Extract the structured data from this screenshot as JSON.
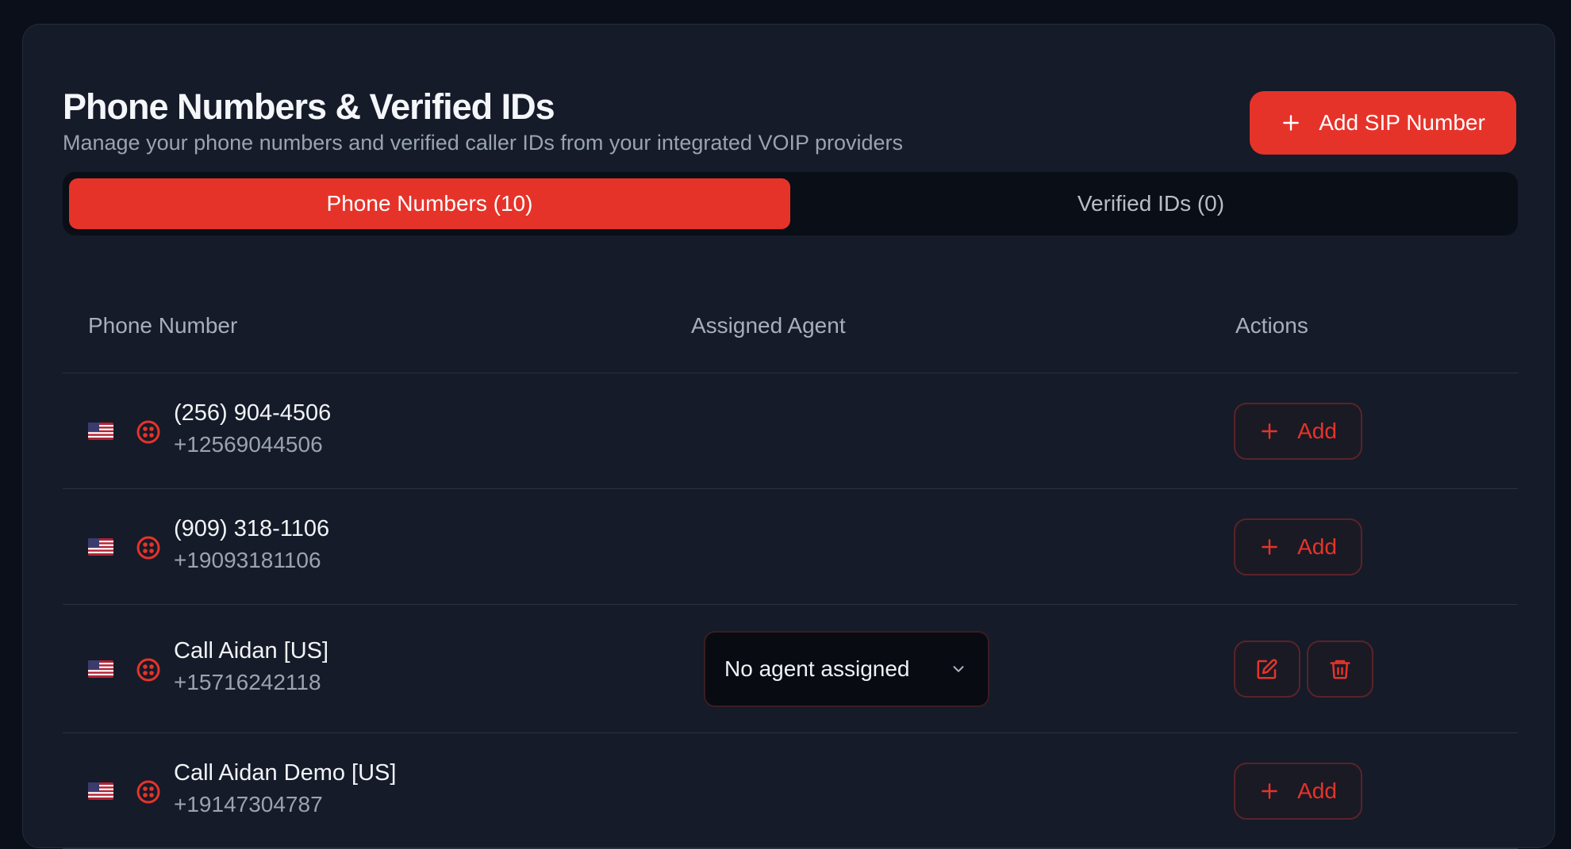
{
  "header": {
    "title": "Phone Numbers & Verified IDs",
    "subtitle": "Manage your phone numbers and verified caller IDs from your integrated VOIP providers",
    "add_sip_label": "Add SIP Number"
  },
  "tabs": [
    {
      "label": "Phone Numbers (10)",
      "active": true
    },
    {
      "label": "Verified IDs (0)",
      "active": false
    }
  ],
  "table": {
    "columns": [
      "Phone Number",
      "Assigned Agent",
      "Actions"
    ],
    "rows": [
      {
        "name": "(256) 904-4506",
        "number": "+12569044506",
        "agent": null,
        "action": "Add"
      },
      {
        "name": "(909) 318-1106",
        "number": "+19093181106",
        "agent": null,
        "action": "Add"
      },
      {
        "name": "Call Aidan [US]",
        "number": "+15716242118",
        "agent": "No agent assigned",
        "action": "edit-delete"
      },
      {
        "name": "Call Aidan Demo [US]",
        "number": "+19147304787",
        "agent": null,
        "action": "Add"
      }
    ]
  },
  "icons": {
    "flag": "us-flag-icon",
    "provider": "twilio-icon",
    "add": "plus-icon",
    "edit": "edit-icon",
    "delete": "trash-icon",
    "dropdown": "chevron-down-icon"
  },
  "colors": {
    "accent": "#e6332a",
    "background": "#0b0f1a",
    "card": "#151b28"
  }
}
